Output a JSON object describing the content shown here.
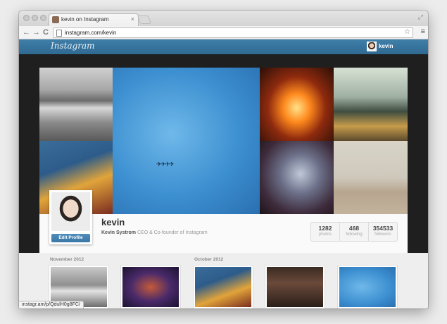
{
  "browser": {
    "tab_title": "kevin on Instagram",
    "tab_close": "×",
    "url": "instagram.com/kevin",
    "status_url": "instagr.am/p/QdulH0g8FC/",
    "back": "←",
    "forward": "→",
    "reload": "C",
    "star": "☆",
    "menu": "≡",
    "fullscreen": "⤢"
  },
  "header": {
    "logo": "Instagram",
    "username": "kevin"
  },
  "profile": {
    "username": "kevin",
    "full_name": "Kevin Systrom",
    "bio": "CEO & Co-founder of Instagram",
    "edit_button": "Edit Profile",
    "stats": [
      {
        "value": "1282",
        "label": "photos"
      },
      {
        "value": "468",
        "label": "following"
      },
      {
        "value": "354533",
        "label": "followers"
      }
    ]
  },
  "feed": {
    "months": [
      "November 2012",
      "October 2012"
    ]
  },
  "icons": {
    "jets": "✈ ✈ ✈ ✈"
  }
}
